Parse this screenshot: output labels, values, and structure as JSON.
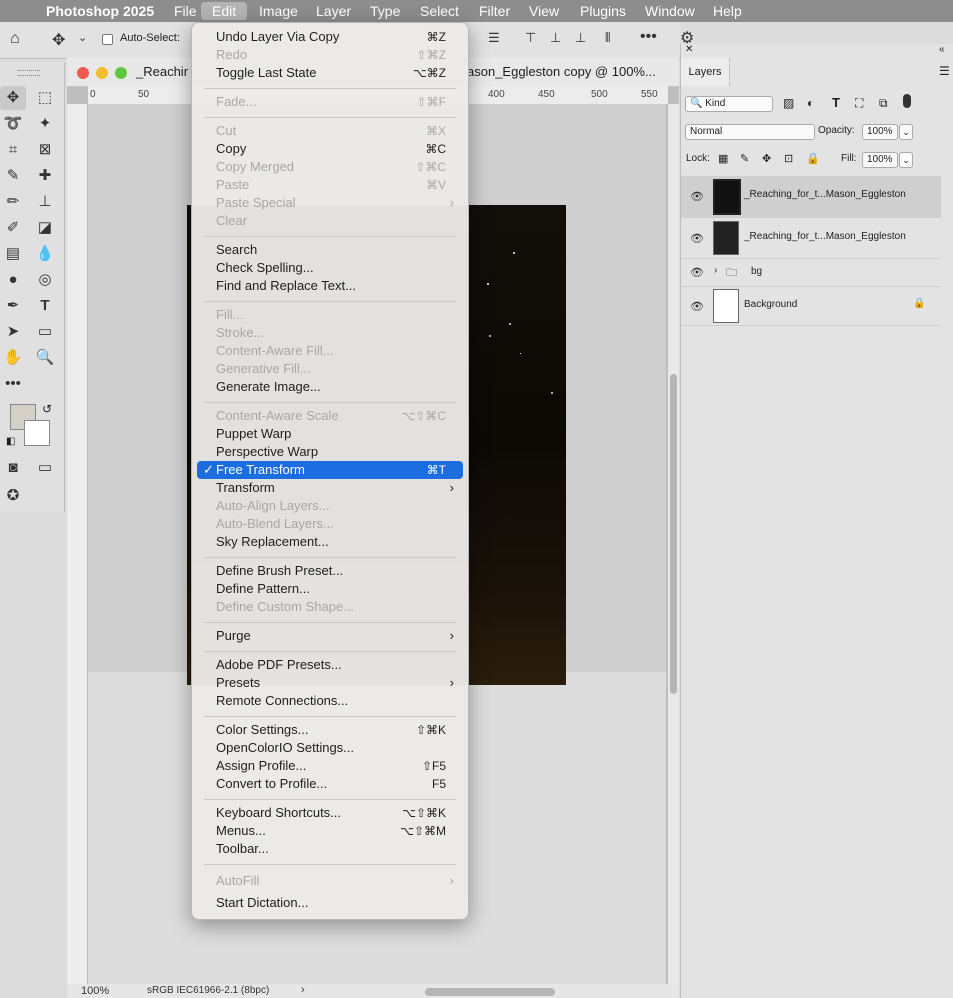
{
  "menubar": {
    "apple": "",
    "app": "Photoshop 2025",
    "items": [
      "File",
      "Edit",
      "Image",
      "Layer",
      "Type",
      "Select",
      "Filter",
      "View",
      "Plugins",
      "Window",
      "Help"
    ]
  },
  "options_bar": {
    "auto_select": "Auto-Select:"
  },
  "document": {
    "tab_left": "_Reachir",
    "tab_right": "ason_Eggleston copy @ 100%...",
    "ruler_top": [
      "0",
      "50",
      "400",
      "450",
      "500",
      "550"
    ],
    "zoom": "100%",
    "profile": "sRGB IEC61966-2.1 (8bpc)"
  },
  "edit_menu": [
    {
      "label": "Undo Layer Via Copy",
      "shortcut": "⌘Z",
      "disabled": false
    },
    {
      "label": "Redo",
      "shortcut": "⇧⌘Z",
      "disabled": true
    },
    {
      "label": "Toggle Last State",
      "shortcut": "⌥⌘Z",
      "disabled": false
    },
    {
      "label": "Fade...",
      "shortcut": "⇧⌘F",
      "disabled": true
    },
    {
      "label": "Cut",
      "shortcut": "⌘X",
      "disabled": true
    },
    {
      "label": "Copy",
      "shortcut": "⌘C",
      "disabled": false
    },
    {
      "label": "Copy Merged",
      "shortcut": "⇧⌘C",
      "disabled": true
    },
    {
      "label": "Paste",
      "shortcut": "⌘V",
      "disabled": true
    },
    {
      "label": "Paste Special",
      "shortcut": "",
      "submenu": true,
      "disabled": true
    },
    {
      "label": "Clear",
      "shortcut": "",
      "disabled": true
    },
    {
      "label": "Search",
      "shortcut": "",
      "disabled": false
    },
    {
      "label": "Check Spelling...",
      "shortcut": "",
      "disabled": false
    },
    {
      "label": "Find and Replace Text...",
      "shortcut": "",
      "disabled": false
    },
    {
      "label": "Fill...",
      "shortcut": "",
      "disabled": true
    },
    {
      "label": "Stroke...",
      "shortcut": "",
      "disabled": true
    },
    {
      "label": "Content-Aware Fill...",
      "shortcut": "",
      "disabled": true
    },
    {
      "label": "Generative Fill...",
      "shortcut": "",
      "disabled": true
    },
    {
      "label": "Generate Image...",
      "shortcut": "",
      "disabled": false
    },
    {
      "label": "Content-Aware Scale",
      "shortcut": "⌥⇧⌘C",
      "disabled": true
    },
    {
      "label": "Puppet Warp",
      "shortcut": "",
      "disabled": false
    },
    {
      "label": "Perspective Warp",
      "shortcut": "",
      "disabled": false
    },
    {
      "label": "Free Transform",
      "shortcut": "⌘T",
      "disabled": false,
      "highlighted": true,
      "check": "✓"
    },
    {
      "label": "Transform",
      "shortcut": "",
      "submenu": true,
      "disabled": false
    },
    {
      "label": "Auto-Align Layers...",
      "shortcut": "",
      "disabled": true
    },
    {
      "label": "Auto-Blend Layers...",
      "shortcut": "",
      "disabled": true
    },
    {
      "label": "Sky Replacement...",
      "shortcut": "",
      "disabled": false
    },
    {
      "label": "Define Brush Preset...",
      "shortcut": "",
      "disabled": false
    },
    {
      "label": "Define Pattern...",
      "shortcut": "",
      "disabled": false
    },
    {
      "label": "Define Custom Shape...",
      "shortcut": "",
      "disabled": true
    },
    {
      "label": "Purge",
      "shortcut": "",
      "submenu": true,
      "disabled": false
    },
    {
      "label": "Adobe PDF Presets...",
      "shortcut": "",
      "disabled": false
    },
    {
      "label": "Presets",
      "shortcut": "",
      "submenu": true,
      "disabled": false
    },
    {
      "label": "Remote Connections...",
      "shortcut": "",
      "disabled": false
    },
    {
      "label": "Color Settings...",
      "shortcut": "⇧⌘K",
      "disabled": false
    },
    {
      "label": "OpenColorIO Settings...",
      "shortcut": "",
      "disabled": false
    },
    {
      "label": "Assign Profile...",
      "shortcut": "⇧F5",
      "disabled": false
    },
    {
      "label": "Convert to Profile...",
      "shortcut": "F5",
      "disabled": false
    },
    {
      "label": "Keyboard Shortcuts...",
      "shortcut": "⌥⇧⌘K",
      "disabled": false
    },
    {
      "label": "Menus...",
      "shortcut": "⌥⇧⌘M",
      "disabled": false
    },
    {
      "label": "Toolbar...",
      "shortcut": "",
      "disabled": false
    },
    {
      "label": "AutoFill",
      "shortcut": "",
      "submenu": true,
      "disabled": true
    },
    {
      "label": "Start Dictation...",
      "shortcut": "",
      "disabled": false
    }
  ],
  "layers_panel": {
    "tab": "Layers",
    "filter": "Kind",
    "blend_mode": "Normal",
    "opacity_label": "Opacity:",
    "opacity": "100%",
    "lock_label": "Lock:",
    "fill_label": "Fill:",
    "fill": "100%",
    "layers": [
      {
        "name": "_Reaching_for_t...Mason_Eggleston",
        "selected": true
      },
      {
        "name": "_Reaching_for_t...Mason_Eggleston",
        "selected": false
      },
      {
        "name": "bg",
        "group": true,
        "selected": false
      },
      {
        "name": "Background",
        "locked": true,
        "selected": false
      }
    ]
  },
  "colors": {
    "menu_highlight": "#1b6de0",
    "menubar": "#8d8d8d"
  }
}
